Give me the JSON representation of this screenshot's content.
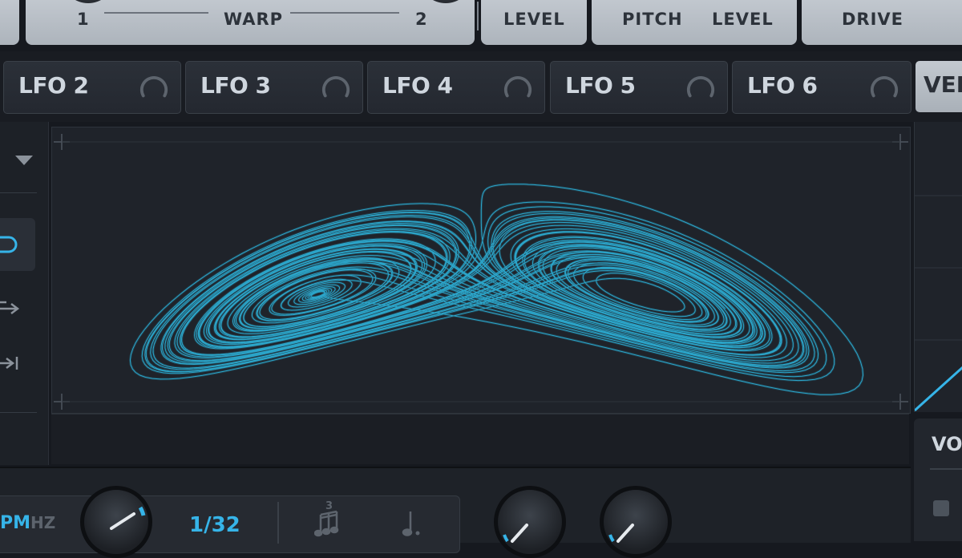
{
  "top": {
    "warp_left": "1",
    "warp_label": "WARP",
    "warp_right": "2",
    "level_1": "LEVEL",
    "pitch": "PITCH",
    "level_2": "LEVEL",
    "drive": "DRIVE"
  },
  "tabs": [
    {
      "label": "LFO 2"
    },
    {
      "label": "LFO 3"
    },
    {
      "label": "LFO 4"
    },
    {
      "label": "LFO 5"
    },
    {
      "label": "LFO 6"
    }
  ],
  "vel_tab": {
    "label": "VEL"
  },
  "right_panel": {
    "label": "VOI"
  },
  "bottom": {
    "mode_bpm": "PM",
    "mode_hz": "HZ",
    "rate_value": "1/32",
    "triplet_number": "3"
  },
  "colors": {
    "attractor": "#2fc6f2",
    "accent": "#36b4e8"
  },
  "icons": {
    "dropdown": "triangle-down",
    "loop": "loop-pill",
    "retrigger": "arrow-right",
    "skip": "skip-end",
    "tab_ring": "arc-ring",
    "triplet": "triplet-notes",
    "dotted": "dotted-quarter-note"
  }
}
